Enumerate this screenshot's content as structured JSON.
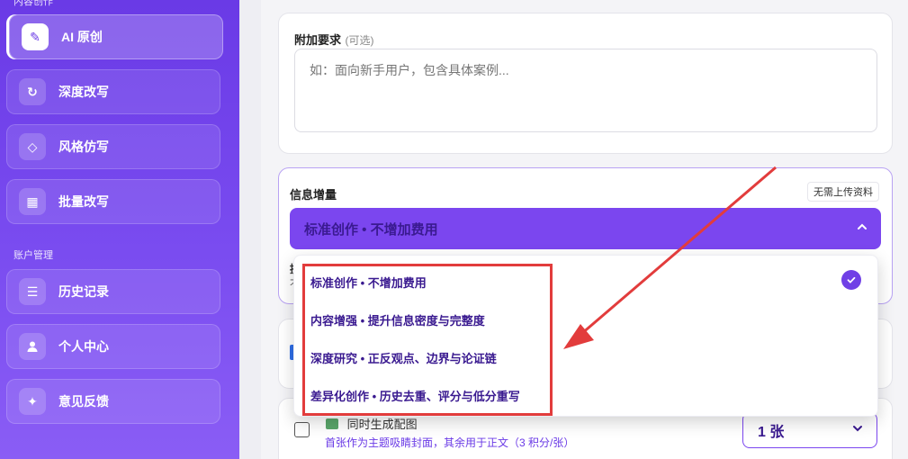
{
  "sidebar": {
    "section_content": "内容创作",
    "section_account": "账户管理",
    "items": [
      {
        "label": "AI 原创",
        "icon": "pen-icon",
        "glyph": "✎"
      },
      {
        "label": "深度改写",
        "icon": "refresh-icon",
        "glyph": "↻"
      },
      {
        "label": "风格仿写",
        "icon": "diamond-icon",
        "glyph": "◇"
      },
      {
        "label": "批量改写",
        "icon": "grid-icon",
        "glyph": "▦"
      },
      {
        "label": "历史记录",
        "icon": "list-icon",
        "glyph": "☰"
      },
      {
        "label": "个人中心",
        "icon": "user-icon",
        "glyph": "👤"
      },
      {
        "label": "意见反馈",
        "icon": "sparkle-icon",
        "glyph": "✦"
      }
    ]
  },
  "extra": {
    "title": "附加要求",
    "optional": "(可选)",
    "placeholder": "如：面向新手用户，包含具体案例..."
  },
  "info": {
    "title": "信息增量",
    "tag": "无需上传资料",
    "selected": "标准创作 • 不增加费用",
    "hint_char_1": "提",
    "hint_char_2": "不"
  },
  "dropdown": {
    "options": [
      "标准创作 • 不增加费用",
      "内容增强 • 提升信息密度与完整度",
      "深度研究 • 正反观点、边界与论证链",
      "差异化创作 • 历史去重、评分与低分重写"
    ],
    "selected_index": 0
  },
  "image_gen": {
    "title": "同时生成配图",
    "desc": "首张作为主题吸睛封面，其余用于正文（3 积分/张）",
    "count": "1 张"
  },
  "colors": {
    "accent": "#7b46ef",
    "highlight": "#e23c3c"
  }
}
